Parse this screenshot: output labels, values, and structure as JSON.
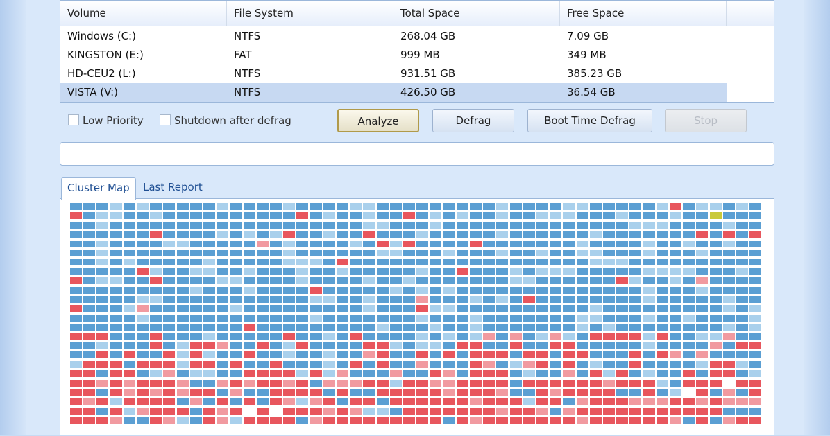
{
  "table": {
    "headers": [
      "Volume",
      "File System",
      "Total Space",
      "Free Space"
    ],
    "rows": [
      {
        "volume": "Windows (C:)",
        "fs": "NTFS",
        "total": "268.04 GB",
        "free": "7.09 GB"
      },
      {
        "volume": "KINGSTON (E:)",
        "fs": "FAT",
        "total": "999 MB",
        "free": "349 MB"
      },
      {
        "volume": "HD-CEU2 (L:)",
        "fs": "NTFS",
        "total": "931.51 GB",
        "free": "385.23 GB"
      },
      {
        "volume": "VISTA (V:)",
        "fs": "NTFS",
        "total": "426.50 GB",
        "free": "36.54 GB"
      }
    ],
    "selected_row": 3
  },
  "options": {
    "low_priority": {
      "label": "Low Priority",
      "checked": false
    },
    "shutdown": {
      "label": "Shutdown after defrag",
      "checked": false
    }
  },
  "buttons": {
    "analyze": "Analyze",
    "defrag": "Defrag",
    "boot_time": "Boot Time Defrag",
    "stop": "Stop"
  },
  "progress": {
    "value": 0
  },
  "tabs": {
    "cluster_map": "Cluster Map",
    "last_report": "Last Report",
    "active": "cluster_map"
  },
  "colors": {
    "used": "#5b9fd3",
    "free": "#a9d0ec",
    "fragmented": "#e8565d",
    "fragmented_light": "#f19aa0",
    "empty": "#ffffff",
    "special": "#c9c93a"
  }
}
